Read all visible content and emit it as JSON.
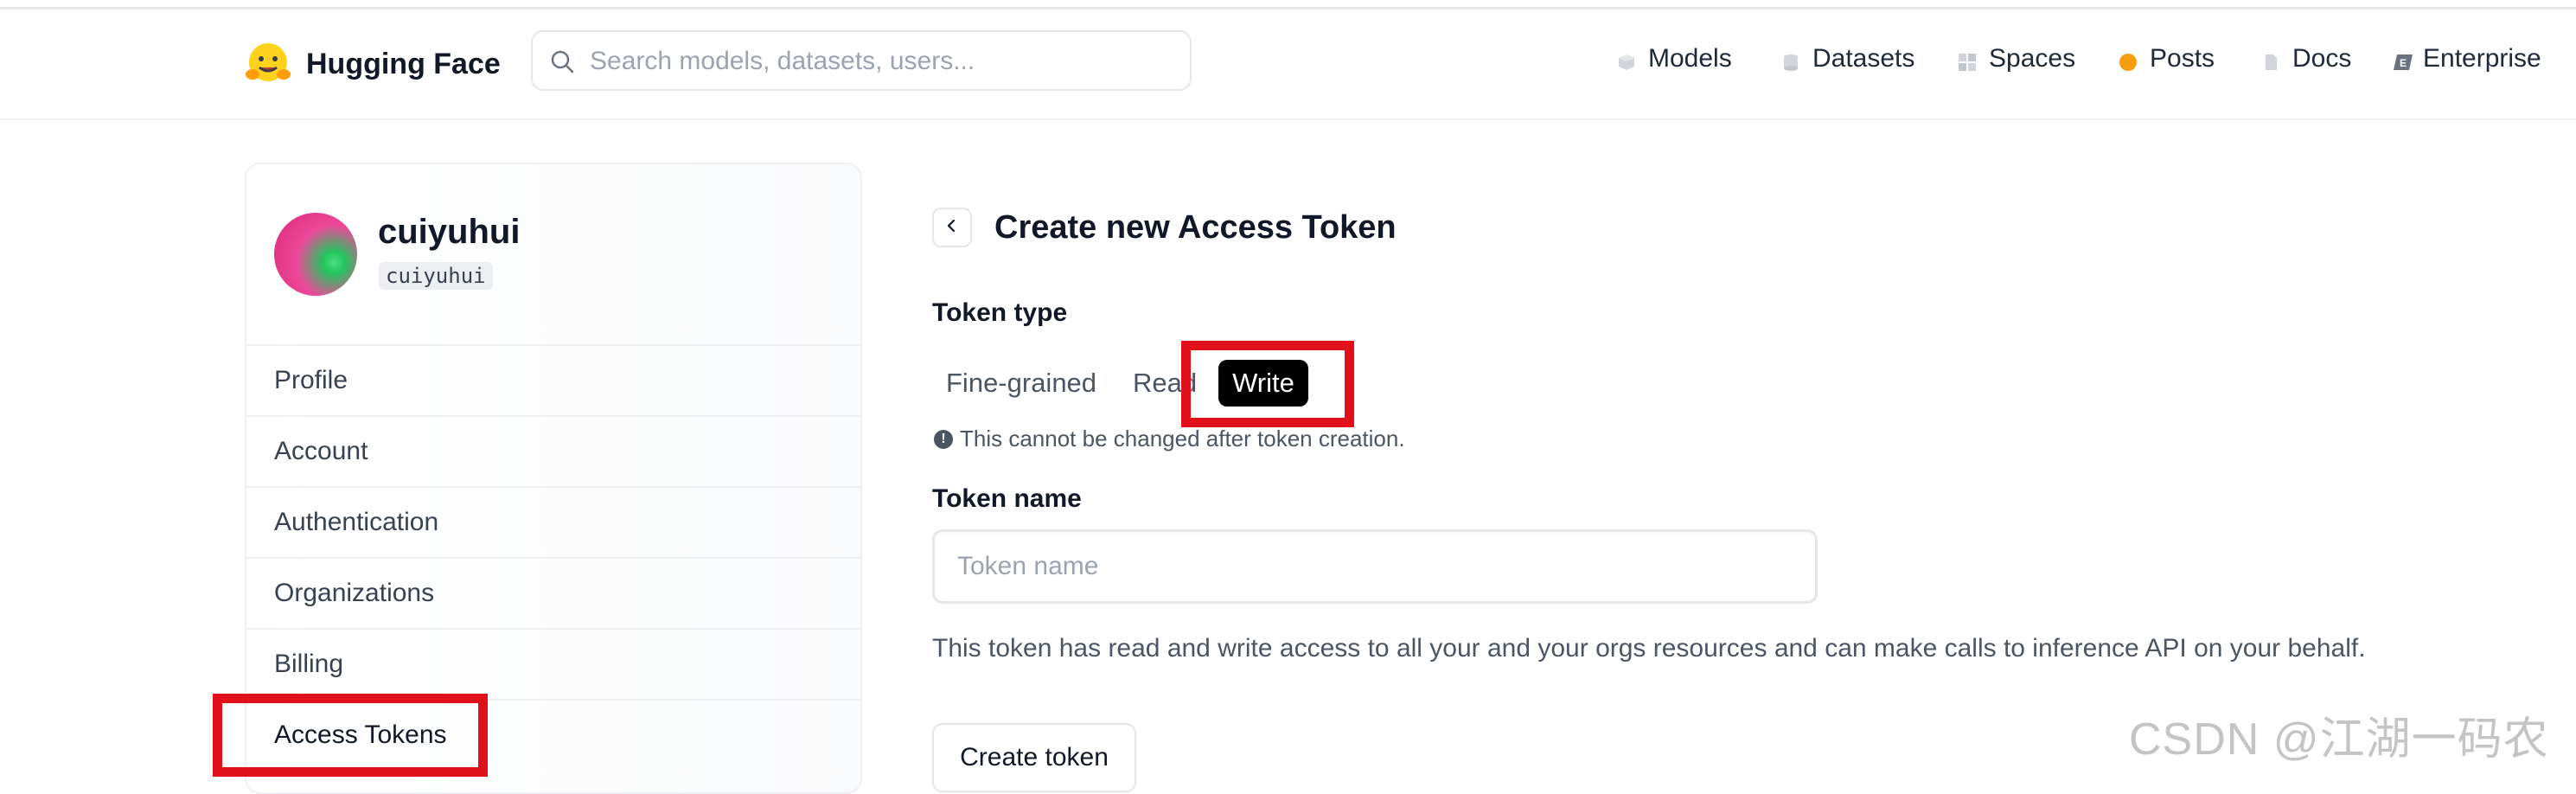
{
  "header": {
    "brand": "Hugging Face",
    "search_placeholder": "Search models, datasets, users...",
    "nav": [
      {
        "label": "Models",
        "icon": "models-icon"
      },
      {
        "label": "Datasets",
        "icon": "datasets-icon"
      },
      {
        "label": "Spaces",
        "icon": "spaces-icon"
      },
      {
        "label": "Posts",
        "icon": "posts-icon"
      },
      {
        "label": "Docs",
        "icon": "docs-icon"
      },
      {
        "label": "Enterprise",
        "icon": "enterprise-icon"
      }
    ]
  },
  "sidebar": {
    "user": {
      "name": "cuiyuhui",
      "handle": "cuiyuhui"
    },
    "items": [
      {
        "label": "Profile"
      },
      {
        "label": "Account"
      },
      {
        "label": "Authentication"
      },
      {
        "label": "Organizations"
      },
      {
        "label": "Billing"
      },
      {
        "label": "Access Tokens",
        "active": true
      }
    ]
  },
  "main": {
    "title": "Create new Access Token",
    "token_type_label": "Token type",
    "token_types": [
      "Fine-grained",
      "Read",
      "Write"
    ],
    "selected_token_type": "Write",
    "hint": "This cannot be changed after token creation.",
    "token_name_label": "Token name",
    "token_name_placeholder": "Token name",
    "token_name_value": "",
    "description": "This token has read and write access to all your and your orgs resources and can make calls to inference API on your behalf.",
    "create_button": "Create token"
  },
  "watermark": "CSDN @江湖一码农",
  "colors": {
    "highlight_box": "#e0111b",
    "active_tab_bg": "#000000",
    "posts_icon": "#f59e0b"
  }
}
